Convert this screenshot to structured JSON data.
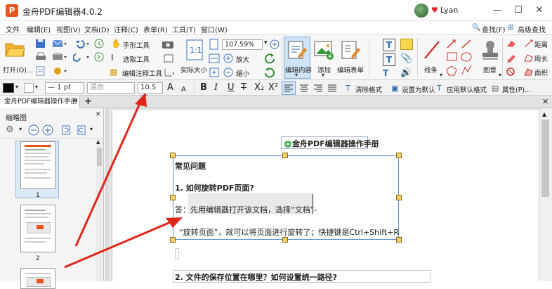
{
  "window": {
    "logo_letter": "P",
    "title": "金舟PDF编辑器4.0.2",
    "username": "Lyan",
    "heart": "♥",
    "minimize": "—",
    "maximize": "☐",
    "close": "✕"
  },
  "menu": {
    "items": [
      "文件",
      "编辑(E)",
      "视图(V)",
      "文档(D)",
      "注释(C)",
      "表单(R)",
      "工具(T)",
      "窗口(W)"
    ],
    "find": "查找(F)",
    "advanced_find": "高级查找(S)"
  },
  "ribbon": {
    "open": "打开(O)...",
    "hand_tool": "手形工具",
    "select_tool": "选取工具",
    "edit_annot_tool": "编辑注释工具",
    "actual_size": "实际大小",
    "zoom_value": "107.59%",
    "zoom_in": "放大",
    "zoom_out": "缩小",
    "edit_content": "编辑内容",
    "add": "添加",
    "edit_form": "编辑表单",
    "line": "线条",
    "stamp": "图章",
    "distance": "距离",
    "perimeter": "周长",
    "area": "面积"
  },
  "format": {
    "blend": "混合",
    "line_width": "— 1 pt",
    "font_size": "10.5 pt",
    "grow_font": "A",
    "shrink_font": "A",
    "bold": "B",
    "italic": "I",
    "underline": "U",
    "strike": "T",
    "subscript": "X₂",
    "superscript": "X²",
    "clear_format": "清除格式",
    "set_default": "设置为默认",
    "apply_default": "应用默认格式",
    "properties": "属性(P)...",
    "colors": {
      "fill": "#000000",
      "accent": "#2b6cb0"
    }
  },
  "tabs": {
    "doc_tab": "金舟PDF编辑器操作手册",
    "close": "✕",
    "add": "+"
  },
  "thumbnails": {
    "title": "缩略图",
    "pages": [
      "1",
      "2"
    ]
  },
  "document": {
    "title": "金舟PDF编辑器操作手册",
    "faq_heading": "常见问题",
    "q1": "1. 如何旋转PDF页面?",
    "a1_line1": "答：先用编辑器打开该文档，选择“文档”-",
    "a1_line2": "“旋转页面”，就可以将页面进行旋转了；快捷键是Ctrl+Shift+R",
    "q2": "2. 文件的保存位置在哪里？如何设置统一路径?"
  }
}
